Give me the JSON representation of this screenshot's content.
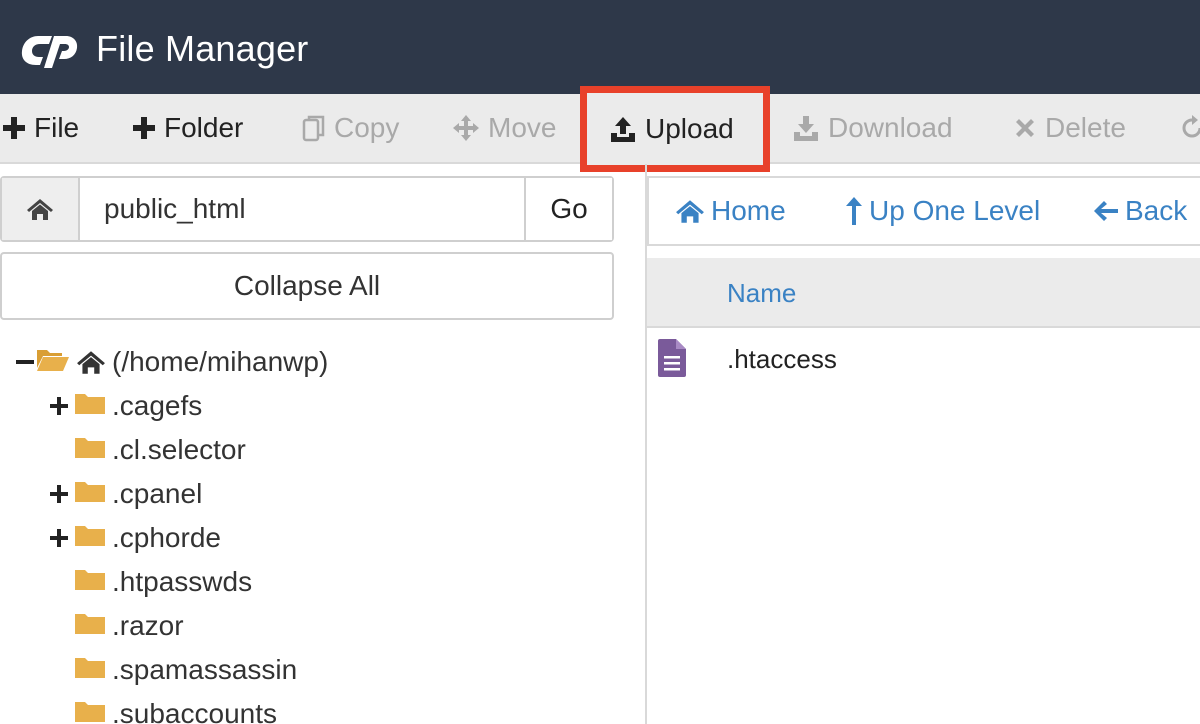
{
  "header": {
    "title": "File Manager",
    "logo": "cP"
  },
  "toolbar": {
    "file": "File",
    "folder": "Folder",
    "copy": "Copy",
    "move": "Move",
    "upload": "Upload",
    "download": "Download",
    "delete": "Delete",
    "highlight_color": "#e8412a"
  },
  "path": {
    "value": "public_html",
    "go": "Go"
  },
  "collapse_all": "Collapse All",
  "tree": {
    "root": "(/home/mihanwp)",
    "items": [
      {
        "label": ".cagefs",
        "expandable": true
      },
      {
        "label": ".cl.selector",
        "expandable": false
      },
      {
        "label": ".cpanel",
        "expandable": true
      },
      {
        "label": ".cphorde",
        "expandable": true
      },
      {
        "label": ".htpasswds",
        "expandable": false
      },
      {
        "label": ".razor",
        "expandable": false
      },
      {
        "label": ".spamassassin",
        "expandable": false
      },
      {
        "label": ".subaccounts",
        "expandable": false
      }
    ]
  },
  "nav": {
    "home": "Home",
    "up_one_level": "Up One Level",
    "back": "Back"
  },
  "file_list": {
    "column_name": "Name",
    "rows": [
      {
        "name": ".htaccess",
        "icon": "file-text-icon"
      }
    ]
  },
  "colors": {
    "header_bg": "#2e3849",
    "link": "#3a82c4",
    "folder": "#e8b04b",
    "file_icon": "#7a5a9a"
  }
}
